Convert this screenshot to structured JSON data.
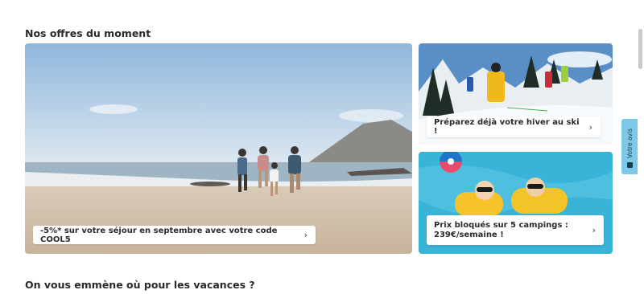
{
  "sections": {
    "offers_title": "Nos offres du moment",
    "destinations_title": "On vous emmène où pour les vacances ?"
  },
  "offers": [
    {
      "label": "-5%* sur votre séjour en septembre avec votre code COOL5",
      "icon": "chevron-right-icon"
    },
    {
      "label": "Préparez déjà votre hiver au ski !",
      "icon": "chevron-right-icon"
    },
    {
      "label": "Prix bloqués sur 5 campings : 239€/semaine !",
      "icon": "chevron-right-icon"
    }
  ],
  "feedback": {
    "label": "Votre avis",
    "icon": "feedback-icon"
  },
  "colors": {
    "feedback_tab": "#7cc9e8",
    "text": "#2b2b2b"
  }
}
